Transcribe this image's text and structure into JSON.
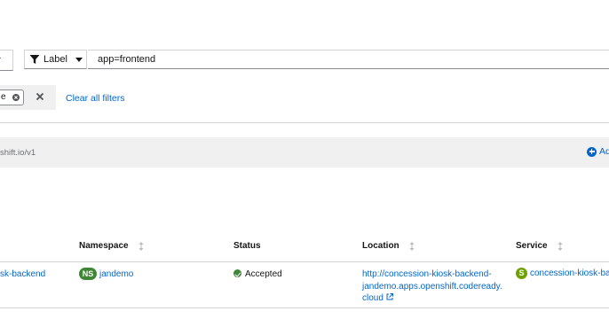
{
  "toolbar": {
    "filter_type_label": "Label",
    "label_input_value": "app=frontend",
    "chip_text": "e",
    "clear_all_label": "Clear all filters"
  },
  "section": {
    "api_version_fragment": "shift.io/v1",
    "add_label": "Ad"
  },
  "table": {
    "columns": {
      "name": "",
      "namespace": "Namespace",
      "status": "Status",
      "location": "Location",
      "service": "Service"
    },
    "rows": [
      {
        "name": "sk-backend",
        "namespace_badge": "NS",
        "namespace": "jandemo",
        "status": "Accepted",
        "location_line1": "http://concession-kiosk-backend-",
        "location_line2": "jandemo.apps.openshift.codeready.",
        "location_line3": "cloud",
        "service_badge": "S",
        "service": "concession-kiosk-backe"
      }
    ]
  },
  "colors": {
    "link": "#0066cc",
    "success": "#3e8635",
    "service_badge": "#6ca100"
  },
  "icons": [
    "caret-down-icon",
    "filter-icon",
    "close-circle-icon",
    "close-icon",
    "plus-circle-icon",
    "sort-icon",
    "check-circle-icon",
    "external-link-icon"
  ]
}
